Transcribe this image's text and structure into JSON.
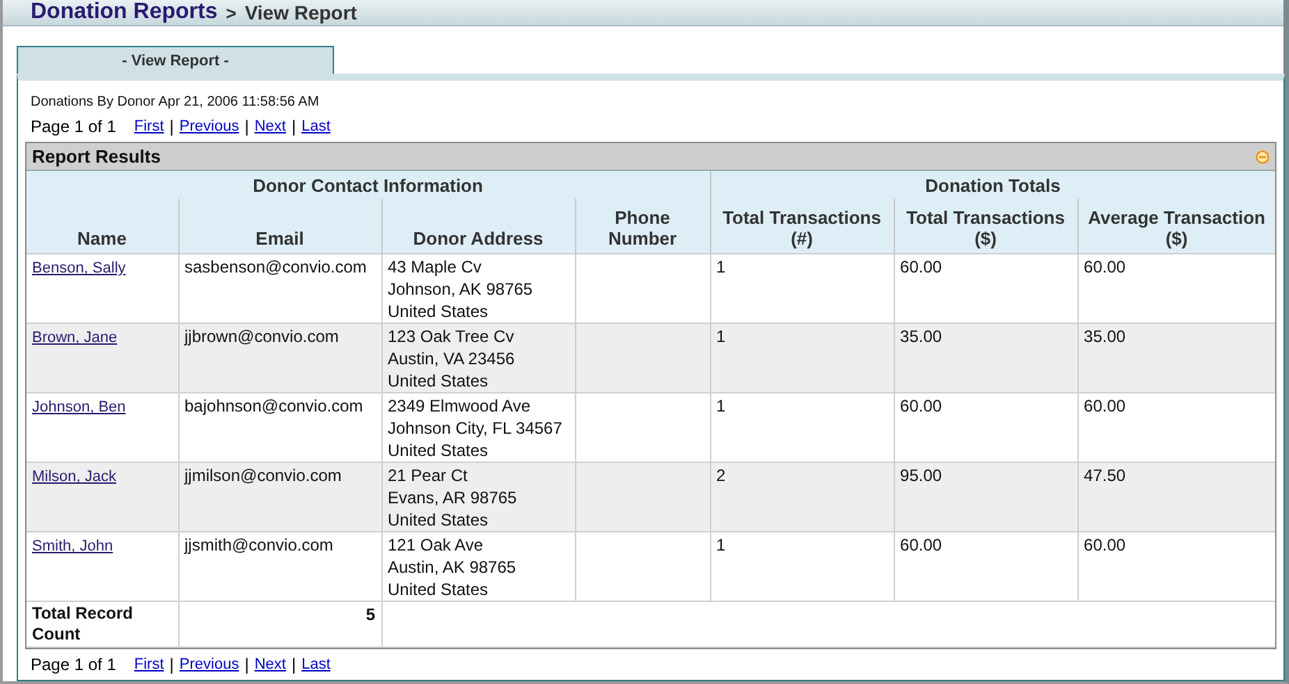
{
  "header": {
    "breadcrumb_link": "Donation Reports",
    "separator": ">",
    "current": "View Report"
  },
  "tabs": [
    {
      "label": "- View Report -",
      "selected": true
    }
  ],
  "report_title": "Donations By Donor Apr 21, 2006 11:58:56 AM",
  "pager_top": {
    "page": "Page 1 of 1",
    "links": [
      "First",
      "Previous",
      "Next",
      "Last"
    ],
    "separator": "|"
  },
  "results": {
    "title": "Report Results",
    "groups": [
      {
        "label": "Donor Contact Information",
        "columns": [
          "Name",
          "Email",
          "Donor Address",
          "Phone\nNumber"
        ]
      },
      {
        "label": "Donation Totals",
        "columns": [
          "Total Transactions\n(#)",
          "Total Transactions\n($)",
          "Average Transaction\n($)"
        ]
      }
    ],
    "rows": [
      {
        "name": "Benson, Sally",
        "email": "sasbenson@convio.com",
        "address": [
          "43 Maple Cv",
          "Johnson, AK 98765",
          "United States"
        ],
        "transactions": "1",
        "total": "60.00",
        "average": "60.00"
      },
      {
        "name": "Brown, Jane",
        "email": "jjbrown@convio.com",
        "address": [
          "123 Oak Tree Cv",
          "Austin, VA 23456",
          "United States"
        ],
        "transactions": "1",
        "total": "35.00",
        "average": "35.00"
      },
      {
        "name": "Johnson, Ben",
        "email": "bajohnson@convio.com",
        "address": [
          "2349 Elmwood Ave",
          "Johnson City, FL 34567",
          "United States"
        ],
        "transactions": "1",
        "total": "60.00",
        "average": "60.00"
      },
      {
        "name": "Milson, Jack",
        "email": "jjmilson@convio.com",
        "address": [
          "21 Pear Ct",
          "Evans, AR 98765",
          "United States"
        ],
        "transactions": "2",
        "total": "95.00",
        "average": "47.50"
      },
      {
        "name": "Smith, John",
        "email": "jjsmith@convio.com",
        "address": [
          "121 Oak Ave",
          "Austin, AK 98765",
          "United States"
        ],
        "transactions": "1",
        "total": "60.00",
        "average": "60.00"
      }
    ],
    "footer": {
      "label": "Total Record Count",
      "value": "5"
    }
  },
  "pager_bottom": {
    "page": "Page 1 of 1",
    "links": [
      "First",
      "Previous",
      "Next",
      "Last"
    ],
    "separator": "|"
  }
}
